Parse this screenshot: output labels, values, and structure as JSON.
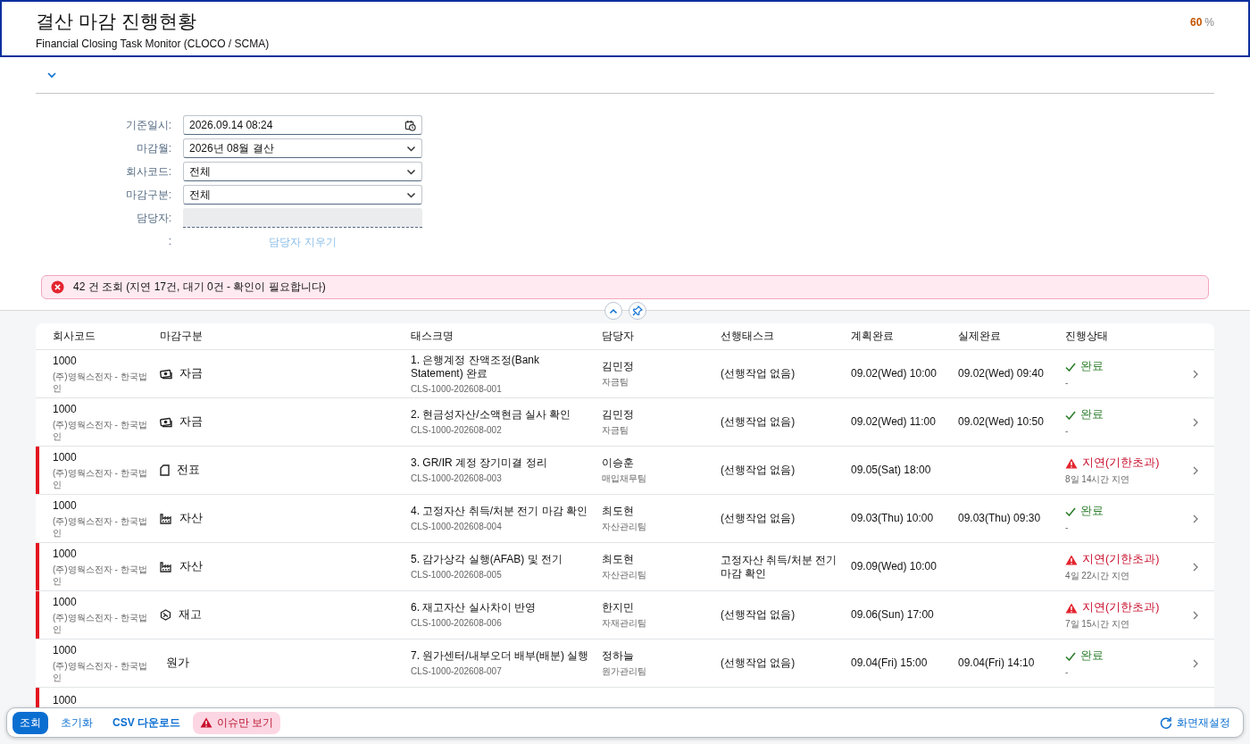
{
  "header": {
    "title": "결산 마감 진행현황",
    "subtitle": "Financial Closing Task Monitor (CLOCO / SCMA)",
    "progress": {
      "value": "60",
      "unit": "%"
    }
  },
  "filter": {
    "fields": [
      {
        "label": "기준일시:",
        "value": "2026.09.14 08:24",
        "kind": "datetime"
      },
      {
        "label": "마감월:",
        "value": "2026년 08월 결산",
        "kind": "select"
      },
      {
        "label": "회사코드:",
        "value": "전체",
        "kind": "select"
      },
      {
        "label": "마감구분:",
        "value": "전체",
        "kind": "select"
      },
      {
        "label": "담당자:",
        "kind": "readonly"
      }
    ],
    "clear": {
      "label": ":",
      "link": "담당자 지우기"
    }
  },
  "message": {
    "text": "42 건 조회 (지연 17건, 대기 0건 - 확인이 필요합니다)"
  },
  "table": {
    "columns": [
      "회사코드",
      "마감구분",
      "태스크명",
      "담당자",
      "선행태스크",
      "계획완료",
      "실제완료",
      "진행상태"
    ],
    "rows": [
      {
        "code": "1000",
        "company": "(주)영웍스전자 - 한국법인",
        "category": {
          "kind": "money",
          "label": "자금"
        },
        "task": "1. 은행계정 잔액조정(Bank Statement) 완료",
        "task_id": "CLS-1000-202608-001",
        "assignee": "김민정",
        "team": "자금팀",
        "predecessor": "(선행작업 없음)",
        "planned": "09.02(Wed) 10:00",
        "actual": "09.02(Wed) 09:40",
        "status": {
          "kind": "done",
          "label": "완료",
          "detail": "-"
        }
      },
      {
        "code": "1000",
        "company": "(주)영웍스전자 - 한국법인",
        "category": {
          "kind": "money",
          "label": "자금"
        },
        "task": "2. 현금성자산/소액현금 실사 확인",
        "task_id": "CLS-1000-202608-002",
        "assignee": "김민정",
        "team": "자금팀",
        "predecessor": "(선행작업 없음)",
        "planned": "09.02(Wed) 11:00",
        "actual": "09.02(Wed) 10:50",
        "status": {
          "kind": "done",
          "label": "완료",
          "detail": "-"
        }
      },
      {
        "code": "1000",
        "company": "(주)영웍스전자 - 한국법인",
        "category": {
          "kind": "document",
          "label": "전표"
        },
        "task": "3. GR/IR 계정 장기미결 정리",
        "task_id": "CLS-1000-202608-003",
        "assignee": "이승훈",
        "team": "매입채무팀",
        "predecessor": "(선행작업 없음)",
        "planned": "09.05(Sat) 18:00",
        "status": {
          "kind": "delayed",
          "label": "지연(기한초과)",
          "detail": "8일 14시간 지연"
        }
      },
      {
        "code": "1000",
        "company": "(주)영웍스전자 - 한국법인",
        "category": {
          "kind": "factory",
          "label": "자산"
        },
        "task": "4. 고정자산 취득/처분 전기 마감 확인",
        "task_id": "CLS-1000-202608-004",
        "assignee": "최도현",
        "team": "자산관리팀",
        "predecessor": "(선행작업 없음)",
        "planned": "09.03(Thu) 10:00",
        "actual": "09.03(Thu) 09:30",
        "status": {
          "kind": "done",
          "label": "완료",
          "detail": "-"
        }
      },
      {
        "code": "1000",
        "company": "(주)영웍스전자 - 한국법인",
        "category": {
          "kind": "factory",
          "label": "자산"
        },
        "task": "5. 감가상각 실행(AFAB) 및 전기",
        "task_id": "CLS-1000-202608-005",
        "assignee": "최도현",
        "team": "자산관리팀",
        "predecessor": "고정자산 취득/처분 전기 마감 확인",
        "planned": "09.09(Wed) 10:00",
        "status": {
          "kind": "delayed",
          "label": "지연(기한초과)",
          "detail": "4일 22시간 지연"
        }
      },
      {
        "code": "1000",
        "company": "(주)영웍스전자 - 한국법인",
        "category": {
          "kind": "box",
          "label": "재고"
        },
        "task": "6. 재고자산 실사차이 반영",
        "task_id": "CLS-1000-202608-006",
        "assignee": "한지민",
        "team": "자재관리팀",
        "predecessor": "(선행작업 없음)",
        "planned": "09.06(Sun) 17:00",
        "status": {
          "kind": "delayed",
          "label": "지연(기한초과)",
          "detail": "7일 15시간 지연"
        }
      },
      {
        "code": "1000",
        "company": "(주)영웍스전자 - 한국법인",
        "category": {
          "kind": "plain",
          "label": "원가"
        },
        "task": "7. 원가센터/내부오더 배부(배분) 실행",
        "task_id": "CLS-1000-202608-007",
        "assignee": "정하늘",
        "team": "원가관리팀",
        "predecessor": "(선행작업 없음)",
        "planned": "09.04(Fri) 15:00",
        "actual": "09.04(Fri) 14:10",
        "status": {
          "kind": "done",
          "label": "완료",
          "detail": "-"
        }
      },
      {
        "code": "1000",
        "status": {
          "kind": "delayed"
        }
      }
    ]
  },
  "footer": {
    "buttons": [
      {
        "label": "조회",
        "kind": "primary"
      },
      {
        "label": "초기화",
        "kind": "link"
      },
      {
        "label": "CSV 다운로드",
        "kind": "strong"
      },
      {
        "label": "이슈만 보기",
        "kind": "issue"
      }
    ],
    "reset": "화면재설정"
  }
}
